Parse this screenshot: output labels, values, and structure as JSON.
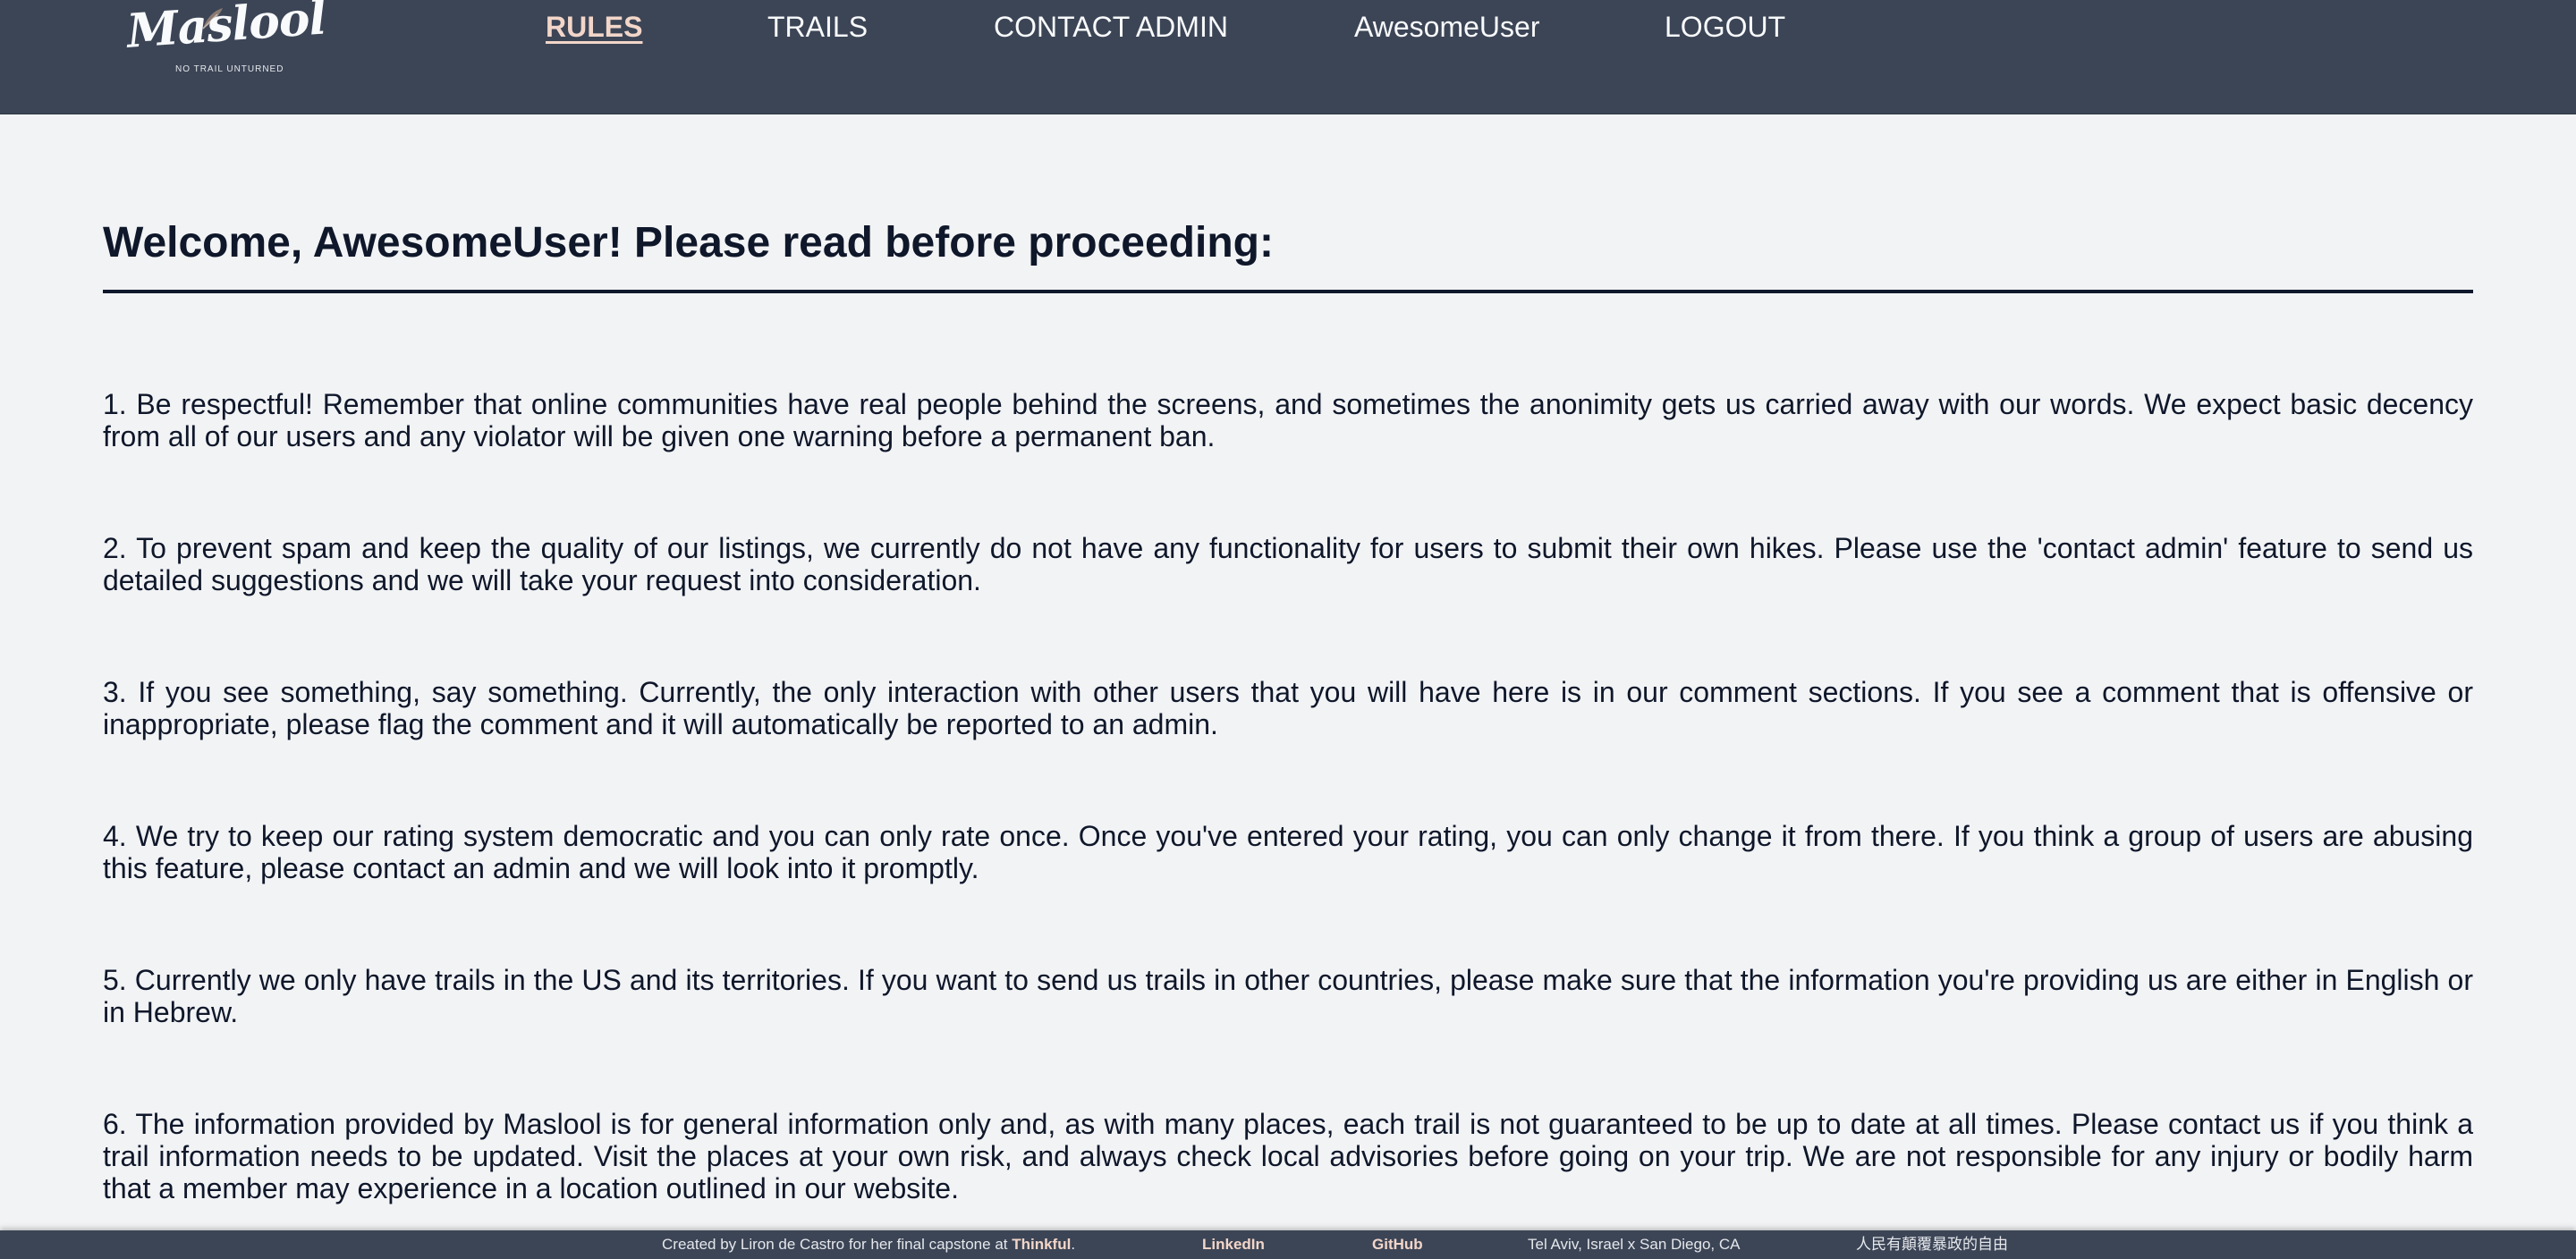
{
  "header": {
    "logo": {
      "name": "Maslool",
      "tagline": "NO TRAIL UNTURNED"
    },
    "nav": {
      "rules": "RULES",
      "trails": "TRAILS",
      "contact_admin": "CONTACT ADMIN",
      "user": "AwesomeUser",
      "logout": "LOGOUT",
      "active": "rules"
    }
  },
  "main": {
    "title": "Welcome, AwesomeUser! Please read before proceeding:",
    "rules": [
      "1. Be respectful! Remember that online communities have real people behind the screens, and sometimes the anonimity gets us carried away with our words. We expect basic decency from all of our users and any violator will be given one warning before a permanent ban.",
      "2. To prevent spam and keep the quality of our listings, we currently do not have any functionality for users to submit their own hikes. Please use the 'contact admin' feature to send us detailed suggestions and we will take your request into consideration.",
      "3. If you see something, say something. Currently, the only interaction with other users that you will have here is in our comment sections. If you see a comment that is offensive or inappropriate, please flag the comment and it will automatically be reported to an admin.",
      "4. We try to keep our rating system democratic and you can only rate once. Once you've entered your rating, you can only change it from there. If you think a group of users are abusing this feature, please contact an admin and we will look into it promptly.",
      "5. Currently we only have trails in the US and its territories. If you want to send us trails in other countries, please make sure that the information you're providing us are either in English or in Hebrew.",
      "6. The information provided by Maslool is for general information only and, as with many places, each trail is not guaranteed to be up to date at all times. Please contact us if you think a trail information needs to be updated. Visit the places at your own risk, and always check local advisories before going on your trip. We are not responsible for any injury or bodily harm that a member may experience in a location outlined in our website."
    ]
  },
  "footer": {
    "credit_prefix": "Created by Liron de Castro for her final capstone at ",
    "credit_link": "Thinkful",
    "credit_suffix": ".",
    "linkedin": "LinkedIn",
    "github": "GitHub",
    "location": "Tel Aviv, Israel x San Diego, CA",
    "motto": "人民有顛覆暴政的自由"
  },
  "colors": {
    "header_bg": "#3c4556",
    "page_bg": "#f2f3f5",
    "text": "#0f172a",
    "accent": "#f2d6c9"
  }
}
